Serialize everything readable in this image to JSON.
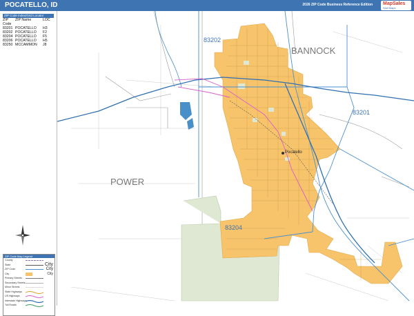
{
  "header": {
    "title": "POCATELLO, ID",
    "edition": "2026 ZIP Code Business Reference Edition",
    "logo_text": "MapSales",
    "logo_sub": "Wall Maps"
  },
  "zip_table": {
    "title": "ZIP Code Index/Grid Locator",
    "columns": [
      "ZIP Code",
      "ZIP Name",
      "LOC"
    ],
    "rows": [
      [
        "83201",
        "POCATELLO",
        "H3"
      ],
      [
        "83202",
        "POCATELLO",
        "F2"
      ],
      [
        "83204",
        "POCATELLO",
        "F5"
      ],
      [
        "83206",
        "POCATELLO",
        "H5"
      ],
      [
        "83250",
        "MCCAMMON",
        "J8"
      ]
    ]
  },
  "legend": {
    "title": "ZIP Code Map Legend",
    "rows": [
      "County",
      "State",
      "ZIP Code",
      "City",
      "Primary Streets",
      "Secondary Streets",
      "Minor Streets",
      "State Highways",
      "US Highways",
      "Interstate Highways",
      "Toll Roads"
    ],
    "symbols": [
      "City",
      "City",
      "City"
    ]
  },
  "map": {
    "county_labels": [
      "POWER",
      "BANNOCK"
    ],
    "zip_labels": [
      "83202",
      "83201",
      "83204"
    ],
    "city_label": "Pocatello",
    "colors": {
      "city_fill": "#f7c46c",
      "park_fill": "#dfe8d2",
      "water": "#4a90c8",
      "zip_boundary": "#4a8fd0",
      "interstate": "#2f6fb0",
      "us_highway": "#d95fc8",
      "streets": "#9a9a9a"
    }
  }
}
